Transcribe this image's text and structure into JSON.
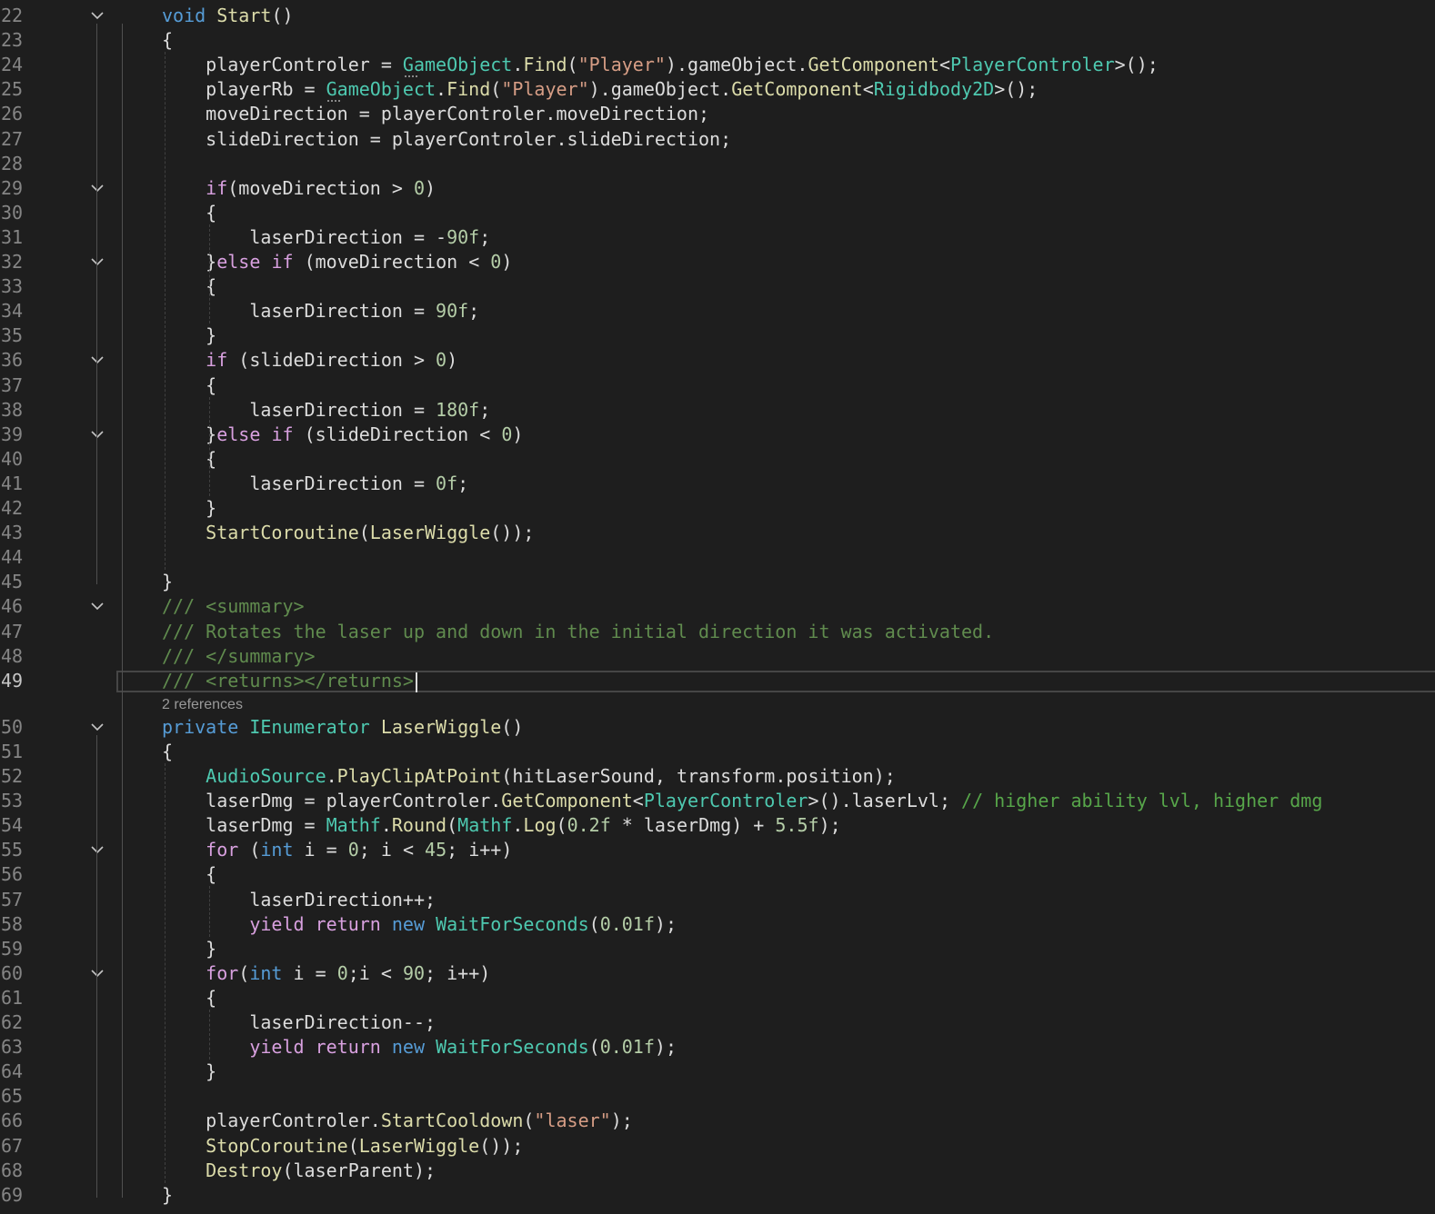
{
  "editor": {
    "codelens_text": "2 references",
    "current_line": "49",
    "lines": [
      {
        "n": "22",
        "fold": true,
        "tokens": [
          [
            "kw",
            "void"
          ],
          [
            "p",
            " "
          ],
          [
            "fn",
            "Start"
          ],
          [
            "p",
            "()"
          ]
        ]
      },
      {
        "n": "23",
        "fold": false,
        "tokens": [
          [
            "p",
            "{"
          ]
        ]
      },
      {
        "n": "24",
        "fold": false,
        "tokens": [
          [
            "p",
            "    playerControler = "
          ],
          [
            "type",
            "GameObject"
          ],
          [
            "p",
            "."
          ],
          [
            "fn",
            "Find"
          ],
          [
            "p",
            "("
          ],
          [
            "str",
            "\"Player\""
          ],
          [
            "p",
            ").gameObject."
          ],
          [
            "fn",
            "GetComponent"
          ],
          [
            "p",
            "<"
          ],
          [
            "type",
            "PlayerControler"
          ],
          [
            "p",
            ">();"
          ]
        ]
      },
      {
        "n": "25",
        "fold": false,
        "tokens": [
          [
            "p",
            "    playerRb = "
          ],
          [
            "type",
            "GameObject"
          ],
          [
            "p",
            "."
          ],
          [
            "fn",
            "Find"
          ],
          [
            "p",
            "("
          ],
          [
            "str",
            "\"Player\""
          ],
          [
            "p",
            ").gameObject."
          ],
          [
            "fn",
            "GetComponent"
          ],
          [
            "p",
            "<"
          ],
          [
            "type",
            "Rigidbody2D"
          ],
          [
            "p",
            ">();"
          ]
        ]
      },
      {
        "n": "26",
        "fold": false,
        "tokens": [
          [
            "p",
            "    moveDirection = playerControler.moveDirection;"
          ]
        ]
      },
      {
        "n": "27",
        "fold": false,
        "tokens": [
          [
            "p",
            "    slideDirection = playerControler.slideDirection;"
          ]
        ]
      },
      {
        "n": "28",
        "fold": false,
        "tokens": []
      },
      {
        "n": "29",
        "fold": true,
        "tokens": [
          [
            "p",
            "    "
          ],
          [
            "ctl",
            "if"
          ],
          [
            "p",
            "(moveDirection > "
          ],
          [
            "num",
            "0"
          ],
          [
            "p",
            ")"
          ]
        ]
      },
      {
        "n": "30",
        "fold": false,
        "tokens": [
          [
            "p",
            "    {"
          ]
        ]
      },
      {
        "n": "31",
        "fold": false,
        "tokens": [
          [
            "p",
            "        laserDirection = -"
          ],
          [
            "num",
            "90f"
          ],
          [
            "p",
            ";"
          ]
        ]
      },
      {
        "n": "32",
        "fold": true,
        "tokens": [
          [
            "p",
            "    }"
          ],
          [
            "ctl",
            "else"
          ],
          [
            "p",
            " "
          ],
          [
            "ctl",
            "if"
          ],
          [
            "p",
            " (moveDirection < "
          ],
          [
            "num",
            "0"
          ],
          [
            "p",
            ")"
          ]
        ]
      },
      {
        "n": "33",
        "fold": false,
        "tokens": [
          [
            "p",
            "    {"
          ]
        ]
      },
      {
        "n": "34",
        "fold": false,
        "tokens": [
          [
            "p",
            "        laserDirection = "
          ],
          [
            "num",
            "90f"
          ],
          [
            "p",
            ";"
          ]
        ]
      },
      {
        "n": "35",
        "fold": false,
        "tokens": [
          [
            "p",
            "    }"
          ]
        ]
      },
      {
        "n": "36",
        "fold": true,
        "tokens": [
          [
            "p",
            "    "
          ],
          [
            "ctl",
            "if"
          ],
          [
            "p",
            " (slideDirection > "
          ],
          [
            "num",
            "0"
          ],
          [
            "p",
            ")"
          ]
        ]
      },
      {
        "n": "37",
        "fold": false,
        "tokens": [
          [
            "p",
            "    {"
          ]
        ]
      },
      {
        "n": "38",
        "fold": false,
        "tokens": [
          [
            "p",
            "        laserDirection = "
          ],
          [
            "num",
            "180f"
          ],
          [
            "p",
            ";"
          ]
        ]
      },
      {
        "n": "39",
        "fold": true,
        "tokens": [
          [
            "p",
            "    }"
          ],
          [
            "ctl",
            "else"
          ],
          [
            "p",
            " "
          ],
          [
            "ctl",
            "if"
          ],
          [
            "p",
            " (slideDirection < "
          ],
          [
            "num",
            "0"
          ],
          [
            "p",
            ")"
          ]
        ]
      },
      {
        "n": "40",
        "fold": false,
        "tokens": [
          [
            "p",
            "    {"
          ]
        ]
      },
      {
        "n": "41",
        "fold": false,
        "tokens": [
          [
            "p",
            "        laserDirection = "
          ],
          [
            "num",
            "0f"
          ],
          [
            "p",
            ";"
          ]
        ]
      },
      {
        "n": "42",
        "fold": false,
        "tokens": [
          [
            "p",
            "    }"
          ]
        ]
      },
      {
        "n": "43",
        "fold": false,
        "tokens": [
          [
            "p",
            "    "
          ],
          [
            "fn",
            "StartCoroutine"
          ],
          [
            "p",
            "("
          ],
          [
            "fn",
            "LaserWiggle"
          ],
          [
            "p",
            "());"
          ]
        ]
      },
      {
        "n": "44",
        "fold": false,
        "tokens": []
      },
      {
        "n": "45",
        "fold": false,
        "tokens": [
          [
            "p",
            "}"
          ]
        ]
      },
      {
        "n": "46",
        "fold": true,
        "tokens": [
          [
            "doc",
            "/// <summary>"
          ]
        ]
      },
      {
        "n": "47",
        "fold": false,
        "tokens": [
          [
            "doc",
            "/// Rotates the laser up and down in the initial direction it was activated."
          ]
        ]
      },
      {
        "n": "48",
        "fold": false,
        "tokens": [
          [
            "doc",
            "/// </summary>"
          ]
        ]
      },
      {
        "n": "49",
        "fold": false,
        "tokens": [
          [
            "doc",
            "/// <returns></returns>"
          ]
        ]
      },
      {
        "n": "50",
        "fold": true,
        "tokens": [
          [
            "kw",
            "private"
          ],
          [
            "p",
            " "
          ],
          [
            "type",
            "IEnumerator"
          ],
          [
            "p",
            " "
          ],
          [
            "fn",
            "LaserWiggle"
          ],
          [
            "p",
            "()"
          ]
        ]
      },
      {
        "n": "51",
        "fold": false,
        "tokens": [
          [
            "p",
            "{"
          ]
        ]
      },
      {
        "n": "52",
        "fold": false,
        "tokens": [
          [
            "p",
            "    "
          ],
          [
            "type",
            "AudioSource"
          ],
          [
            "p",
            "."
          ],
          [
            "fn",
            "PlayClipAtPoint"
          ],
          [
            "p",
            "(hitLaserSound, transform.position);"
          ]
        ]
      },
      {
        "n": "53",
        "fold": false,
        "tokens": [
          [
            "p",
            "    laserDmg = playerControler."
          ],
          [
            "fn",
            "GetComponent"
          ],
          [
            "p",
            "<"
          ],
          [
            "type",
            "PlayerControler"
          ],
          [
            "p",
            ">().laserLvl; "
          ],
          [
            "cmt",
            "// higher ability lvl, higher dmg"
          ]
        ]
      },
      {
        "n": "54",
        "fold": false,
        "tokens": [
          [
            "p",
            "    laserDmg = "
          ],
          [
            "type",
            "Mathf"
          ],
          [
            "p",
            "."
          ],
          [
            "fn",
            "Round"
          ],
          [
            "p",
            "("
          ],
          [
            "type",
            "Mathf"
          ],
          [
            "p",
            "."
          ],
          [
            "fn",
            "Log"
          ],
          [
            "p",
            "("
          ],
          [
            "num",
            "0.2f"
          ],
          [
            "p",
            " * laserDmg) + "
          ],
          [
            "num",
            "5.5f"
          ],
          [
            "p",
            ");"
          ]
        ]
      },
      {
        "n": "55",
        "fold": true,
        "tokens": [
          [
            "p",
            "    "
          ],
          [
            "ctl",
            "for"
          ],
          [
            "p",
            " ("
          ],
          [
            "kw",
            "int"
          ],
          [
            "p",
            " i = "
          ],
          [
            "num",
            "0"
          ],
          [
            "p",
            "; i < "
          ],
          [
            "num",
            "45"
          ],
          [
            "p",
            "; i++)"
          ]
        ]
      },
      {
        "n": "56",
        "fold": false,
        "tokens": [
          [
            "p",
            "    {"
          ]
        ]
      },
      {
        "n": "57",
        "fold": false,
        "tokens": [
          [
            "p",
            "        laserDirection++;"
          ]
        ]
      },
      {
        "n": "58",
        "fold": false,
        "tokens": [
          [
            "p",
            "        "
          ],
          [
            "ctl",
            "yield"
          ],
          [
            "p",
            " "
          ],
          [
            "ctl",
            "return"
          ],
          [
            "p",
            " "
          ],
          [
            "kw",
            "new"
          ],
          [
            "p",
            " "
          ],
          [
            "type",
            "WaitForSeconds"
          ],
          [
            "p",
            "("
          ],
          [
            "num",
            "0.01f"
          ],
          [
            "p",
            ");"
          ]
        ]
      },
      {
        "n": "59",
        "fold": false,
        "tokens": [
          [
            "p",
            "    }"
          ]
        ]
      },
      {
        "n": "60",
        "fold": true,
        "tokens": [
          [
            "p",
            "    "
          ],
          [
            "ctl",
            "for"
          ],
          [
            "p",
            "("
          ],
          [
            "kw",
            "int"
          ],
          [
            "p",
            " i = "
          ],
          [
            "num",
            "0"
          ],
          [
            "p",
            ";i < "
          ],
          [
            "num",
            "90"
          ],
          [
            "p",
            "; i++)"
          ]
        ]
      },
      {
        "n": "61",
        "fold": false,
        "tokens": [
          [
            "p",
            "    {"
          ]
        ]
      },
      {
        "n": "62",
        "fold": false,
        "tokens": [
          [
            "p",
            "        laserDirection--;"
          ]
        ]
      },
      {
        "n": "63",
        "fold": false,
        "tokens": [
          [
            "p",
            "        "
          ],
          [
            "ctl",
            "yield"
          ],
          [
            "p",
            " "
          ],
          [
            "ctl",
            "return"
          ],
          [
            "p",
            " "
          ],
          [
            "kw",
            "new"
          ],
          [
            "p",
            " "
          ],
          [
            "type",
            "WaitForSeconds"
          ],
          [
            "p",
            "("
          ],
          [
            "num",
            "0.01f"
          ],
          [
            "p",
            ");"
          ]
        ]
      },
      {
        "n": "64",
        "fold": false,
        "tokens": [
          [
            "p",
            "    }"
          ]
        ]
      },
      {
        "n": "65",
        "fold": false,
        "tokens": []
      },
      {
        "n": "66",
        "fold": false,
        "tokens": [
          [
            "p",
            "    playerControler."
          ],
          [
            "fn",
            "StartCooldown"
          ],
          [
            "p",
            "("
          ],
          [
            "str",
            "\"laser\""
          ],
          [
            "p",
            ");"
          ]
        ]
      },
      {
        "n": "67",
        "fold": false,
        "tokens": [
          [
            "p",
            "    "
          ],
          [
            "fn",
            "StopCoroutine"
          ],
          [
            "p",
            "("
          ],
          [
            "fn",
            "LaserWiggle"
          ],
          [
            "p",
            "());"
          ]
        ]
      },
      {
        "n": "68",
        "fold": false,
        "tokens": [
          [
            "p",
            "    "
          ],
          [
            "fn",
            "Destroy"
          ],
          [
            "p",
            "(laserParent);"
          ]
        ]
      },
      {
        "n": "69",
        "fold": false,
        "tokens": [
          [
            "p",
            "}"
          ]
        ]
      }
    ]
  },
  "colors": {
    "background": "#1e1e1e",
    "keyword": "#569cd6",
    "control": "#d8a0df",
    "type": "#4ec9b0",
    "method": "#dcdcaa",
    "string": "#d69d85",
    "number": "#b5cea8",
    "comment": "#57a64a",
    "doc_comment": "#608b4e",
    "plain": "#dcdcdc",
    "line_number": "#858585"
  }
}
